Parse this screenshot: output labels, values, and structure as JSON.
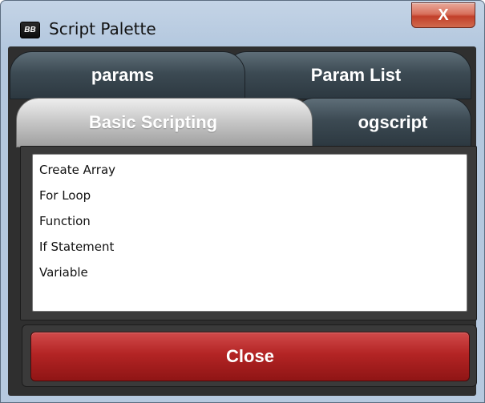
{
  "window": {
    "title": "Script Palette",
    "app_icon_text": "BB",
    "close_glyph": "X"
  },
  "tabs_row1": [
    {
      "label": "params"
    },
    {
      "label": "Param List"
    }
  ],
  "tabs_row2": [
    {
      "label": "Basic Scripting",
      "selected": true
    },
    {
      "label": "ogscript",
      "selected": false
    }
  ],
  "list": {
    "items": [
      "Create Array",
      "For Loop",
      "Function",
      "If Statement",
      "Variable"
    ]
  },
  "footer": {
    "close_label": "Close"
  },
  "colors": {
    "close_button": "#b32424",
    "tab_dark": "#3c4a53",
    "tab_selected": "#c9c9c9"
  }
}
